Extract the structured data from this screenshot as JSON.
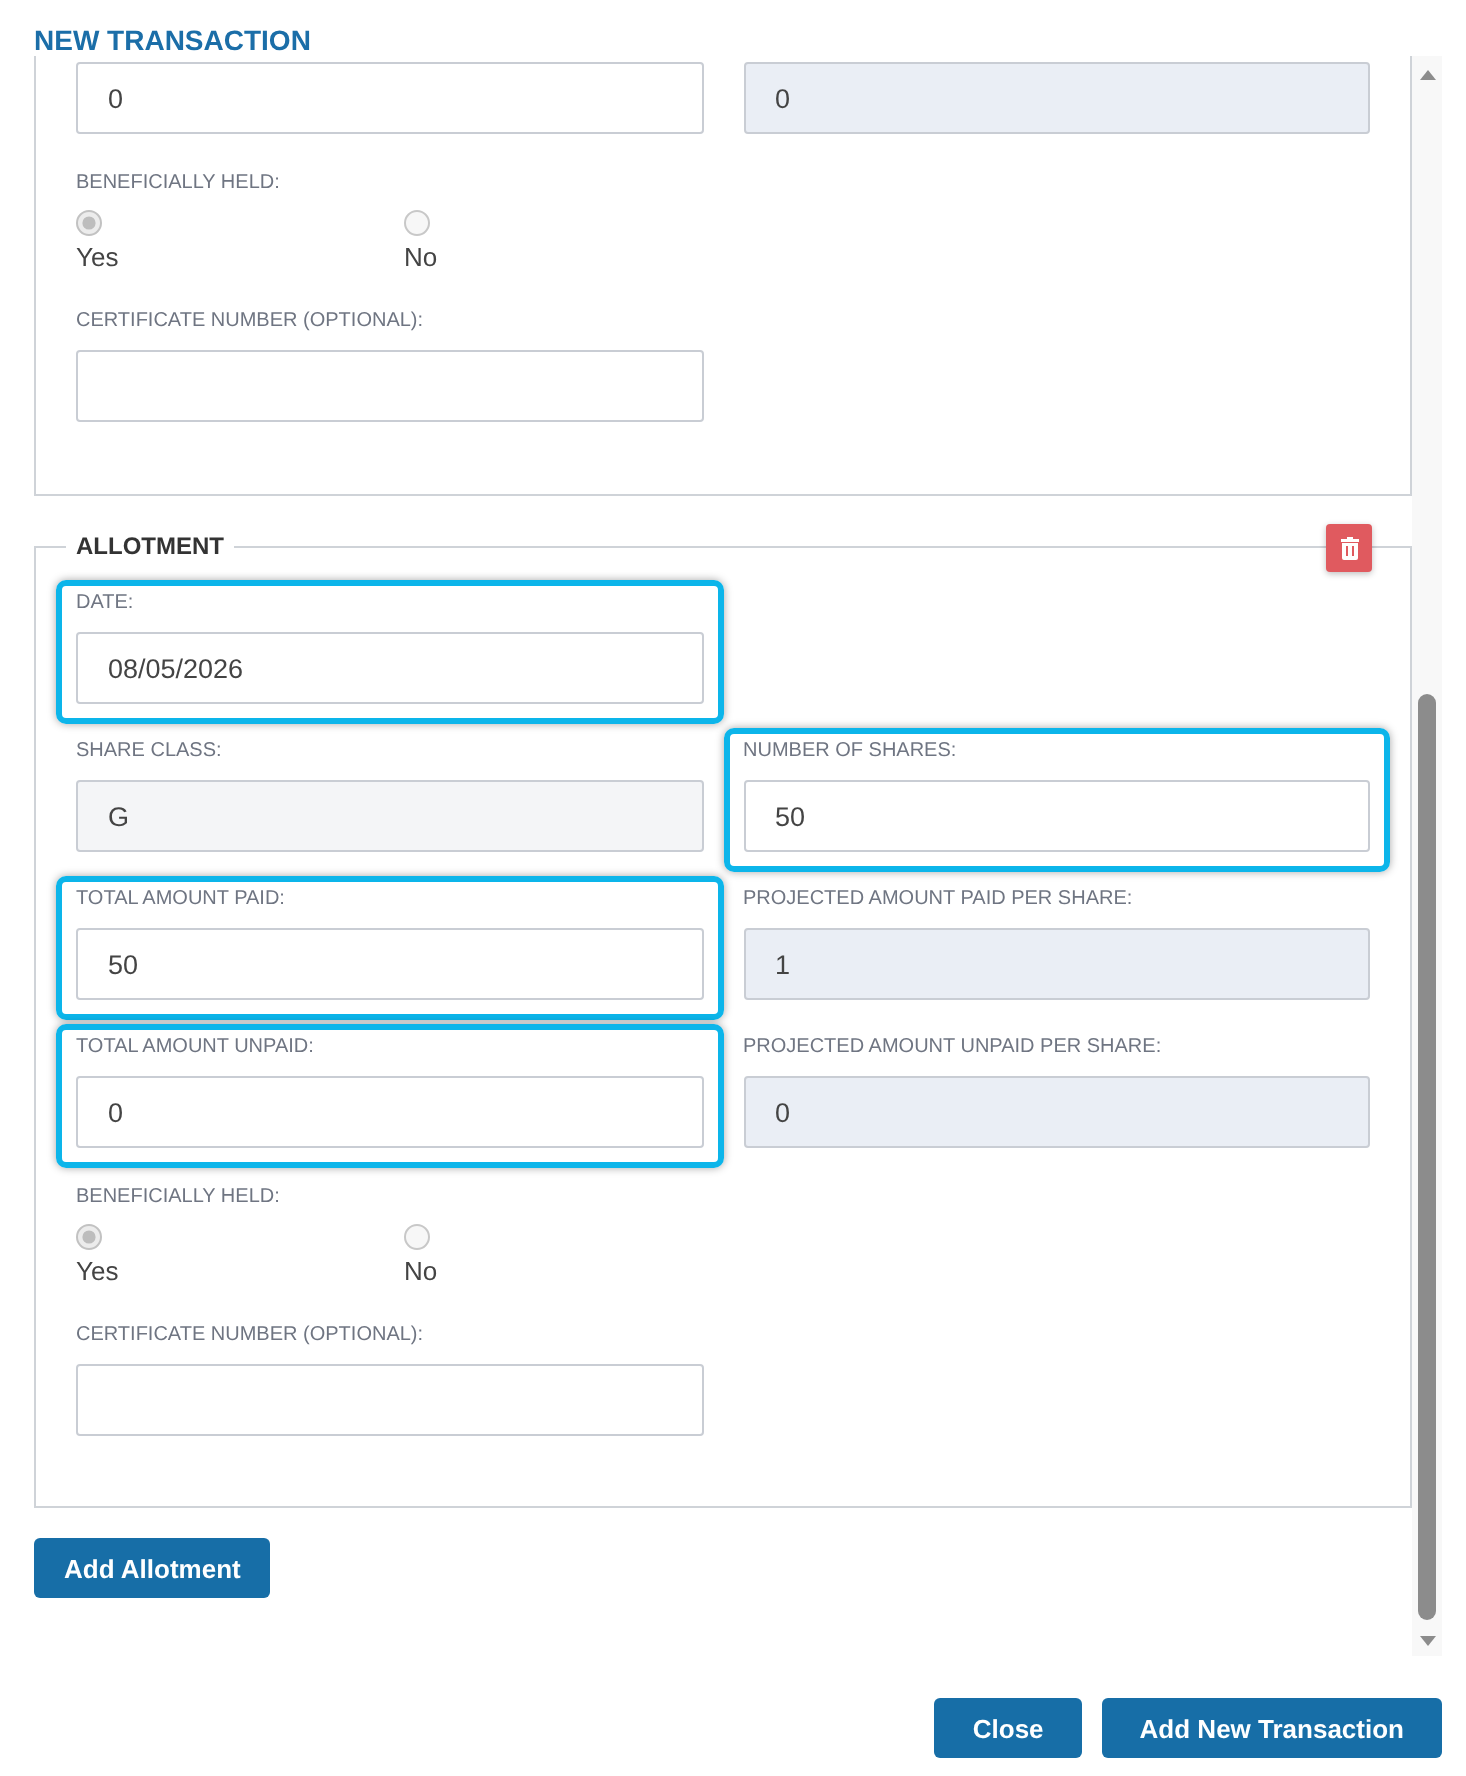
{
  "title": "NEW TRANSACTION",
  "previous_allotment": {
    "fields": [
      {
        "value": "0",
        "kind": "input",
        "highlighted": false
      },
      {
        "value": "0",
        "kind": "readonly",
        "highlighted": false
      }
    ],
    "beneficially_held": {
      "label": "BENEFICIALLY HELD:",
      "options": [
        {
          "label": "Yes",
          "selected": true
        },
        {
          "label": "No",
          "selected": false
        }
      ]
    },
    "certificate_number": {
      "label": "CERTIFICATE NUMBER (OPTIONAL):"
    }
  },
  "allotment": {
    "legend": "ALLOTMENT",
    "rows": [
      [
        {
          "label": "DATE:",
          "value": "08/05/2026",
          "kind": "input",
          "highlighted": true
        }
      ],
      [
        {
          "label": "SHARE CLASS:",
          "value": "G",
          "kind": "select",
          "highlighted": false
        },
        {
          "label": "NUMBER OF SHARES:",
          "value": "50",
          "kind": "input",
          "highlighted": true
        }
      ],
      [
        {
          "label": "TOTAL AMOUNT PAID:",
          "value": "50",
          "kind": "input",
          "highlighted": true
        },
        {
          "label": "PROJECTED AMOUNT PAID PER SHARE:",
          "value": "1",
          "kind": "readonly",
          "highlighted": false
        }
      ],
      [
        {
          "label": "TOTAL AMOUNT UNPAID:",
          "value": "0",
          "kind": "input",
          "highlighted": true
        },
        {
          "label": "PROJECTED AMOUNT UNPAID PER SHARE:",
          "value": "0",
          "kind": "readonly",
          "highlighted": false
        }
      ]
    ],
    "beneficially_held": {
      "label": "BENEFICIALLY HELD:",
      "options": [
        {
          "label": "Yes",
          "selected": true
        },
        {
          "label": "No",
          "selected": false
        }
      ]
    },
    "certificate_number": {
      "label": "CERTIFICATE NUMBER (OPTIONAL):"
    }
  },
  "add_allotment_button": "Add Allotment",
  "footer_buttons": [
    "Close",
    "Add New Transaction"
  ]
}
